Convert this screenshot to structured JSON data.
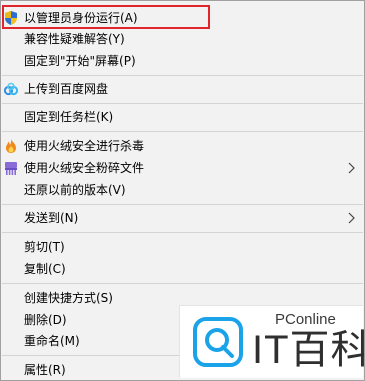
{
  "menu": {
    "items": [
      {
        "label": "以管理员身份运行(A)",
        "icon": "uac-shield-icon",
        "has_submenu": false
      },
      {
        "label": "兼容性疑难解答(Y)",
        "icon": null,
        "has_submenu": false
      },
      {
        "label": "固定到\"开始\"屏幕(P)",
        "icon": null,
        "has_submenu": false
      },
      {
        "label": "上传到百度网盘",
        "icon": "baidu-netdisk-icon",
        "has_submenu": false
      },
      {
        "label": "固定到任务栏(K)",
        "icon": null,
        "has_submenu": false
      },
      {
        "label": "使用火绒安全进行杀毒",
        "icon": "huorong-flame-icon",
        "has_submenu": false
      },
      {
        "label": "使用火绒安全粉碎文件",
        "icon": "huorong-shredder-icon",
        "has_submenu": true
      },
      {
        "label": "还原以前的版本(V)",
        "icon": null,
        "has_submenu": false
      },
      {
        "label": "发送到(N)",
        "icon": null,
        "has_submenu": true
      },
      {
        "label": "剪切(T)",
        "icon": null,
        "has_submenu": false
      },
      {
        "label": "复制(C)",
        "icon": null,
        "has_submenu": false
      },
      {
        "label": "创建快捷方式(S)",
        "icon": null,
        "has_submenu": false
      },
      {
        "label": "删除(D)",
        "icon": null,
        "has_submenu": false
      },
      {
        "label": "重命名(M)",
        "icon": null,
        "has_submenu": false
      },
      {
        "label": "属性(R)",
        "icon": null,
        "has_submenu": false
      }
    ],
    "highlighted_item": "以管理员身份运行(A)"
  },
  "watermark": {
    "small_text": "PConline",
    "big_text": "IT百科",
    "logo_icon": "pconline-logo-icon",
    "accent_color": "#1aa3e8"
  },
  "colors": {
    "menu_background": "#f2f2f2",
    "highlight_border": "#e0262b",
    "separator": "#d4d4d4"
  }
}
